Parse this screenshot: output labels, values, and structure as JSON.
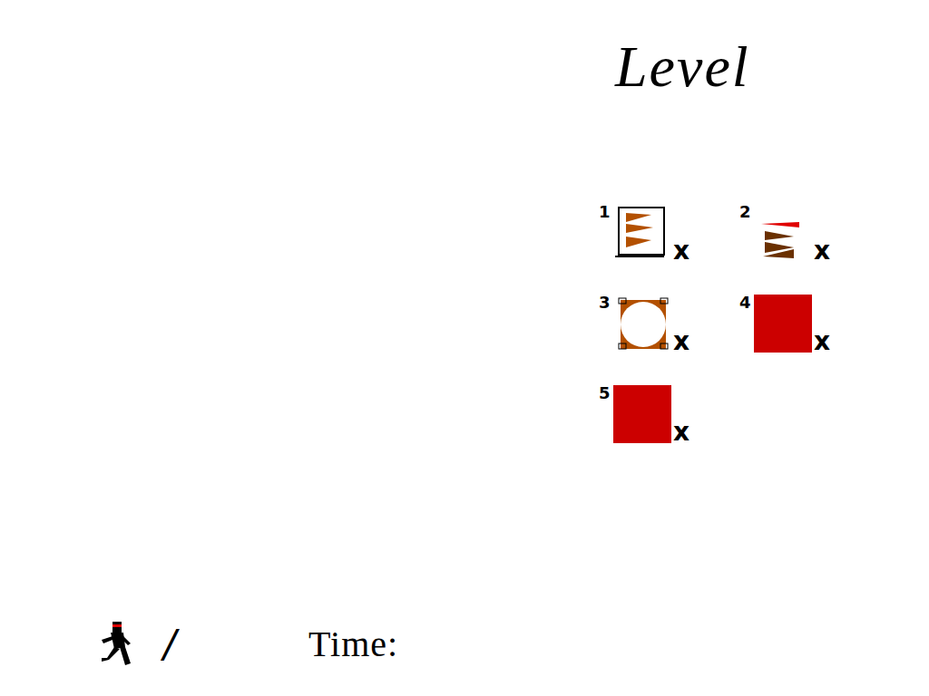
{
  "title": "Level",
  "levels": [
    {
      "number": "1",
      "mark": "x",
      "kind": "crate"
    },
    {
      "number": "2",
      "mark": "x",
      "kind": "spikes"
    },
    {
      "number": "3",
      "mark": "x",
      "kind": "ring"
    },
    {
      "number": "4",
      "mark": "x",
      "kind": "locked",
      "color": "#cc0000"
    },
    {
      "number": "5",
      "mark": "x",
      "kind": "locked",
      "color": "#cc0000"
    }
  ],
  "hud": {
    "lives": "/",
    "time_label": "Time:"
  }
}
